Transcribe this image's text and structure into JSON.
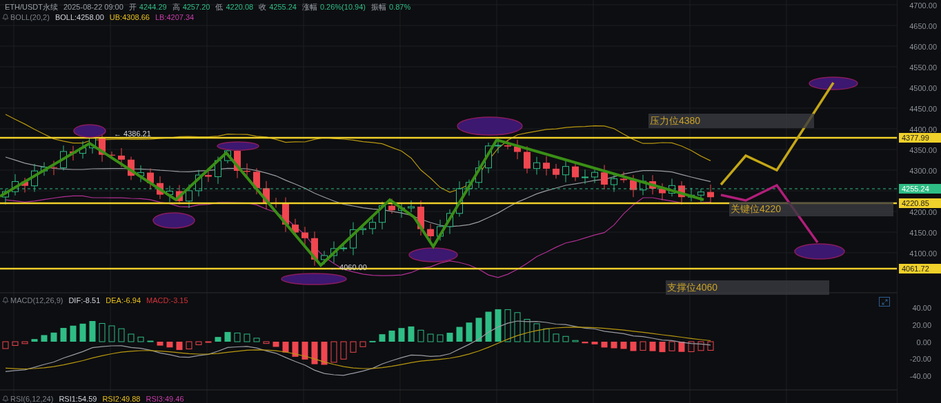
{
  "header": {
    "symbol": "ETH/USDT永续",
    "time": "2025-08-22 09:00",
    "fields": [
      {
        "label": "开",
        "value": "4244.29"
      },
      {
        "label": "高",
        "value": "4257.20"
      },
      {
        "label": "低",
        "value": "4220.08"
      },
      {
        "label": "收",
        "value": "4255.24"
      },
      {
        "label": "涨幅",
        "value": "0.26%(10.94)"
      },
      {
        "label": "振幅",
        "value": "0.87%"
      }
    ]
  },
  "indicators": [
    {
      "name": "BOLL(20,2)",
      "values": [
        {
          "text": "BOLL:4258.00",
          "color": "#d1d4dc"
        },
        {
          "text": "UB:4308.66",
          "color": "#e8c11c"
        },
        {
          "text": "LB:4207.34",
          "color": "#c73dab"
        }
      ]
    },
    {
      "name": "MACD(12,26,9)",
      "values": [
        {
          "text": "DIF:-8.51",
          "color": "#d1d4dc"
        },
        {
          "text": "DEA:-6.94",
          "color": "#e8c11c"
        },
        {
          "text": "MACD:-3.15",
          "color": "#d3313a"
        }
      ]
    },
    {
      "name": "RSI(6,12,24)",
      "values": [
        {
          "text": "RSI1:54.59",
          "color": "#d1d4dc"
        },
        {
          "text": "RSI2:49.88",
          "color": "#e8c11c"
        },
        {
          "text": "RSI3:49.46",
          "color": "#c73dab"
        }
      ]
    }
  ],
  "extremes": [
    {
      "text": "← 4386.21"
    },
    {
      "text": "← 4060.00"
    }
  ],
  "annotations": [
    {
      "text": "压力位4380"
    },
    {
      "text": "关键位4220"
    },
    {
      "text": "支撑位4060"
    }
  ],
  "price_axis": {
    "ticks": [
      "4700.00",
      "4650.00",
      "4600.00",
      "4550.00",
      "4500.00",
      "4450.00",
      "4400.00",
      "4350.00",
      "4300.00",
      "4200.00",
      "4150.00",
      "4100.00"
    ],
    "tags": [
      {
        "text": "4377.99",
        "kind": "level"
      },
      {
        "text": "4255.24",
        "kind": "last"
      },
      {
        "text": "4220.85",
        "kind": "level"
      },
      {
        "text": "4061.72",
        "kind": "level"
      }
    ]
  },
  "macd_axis": {
    "ticks": [
      "40.00",
      "20.00",
      "0.00",
      "-20.00",
      "-40.00"
    ]
  }
}
